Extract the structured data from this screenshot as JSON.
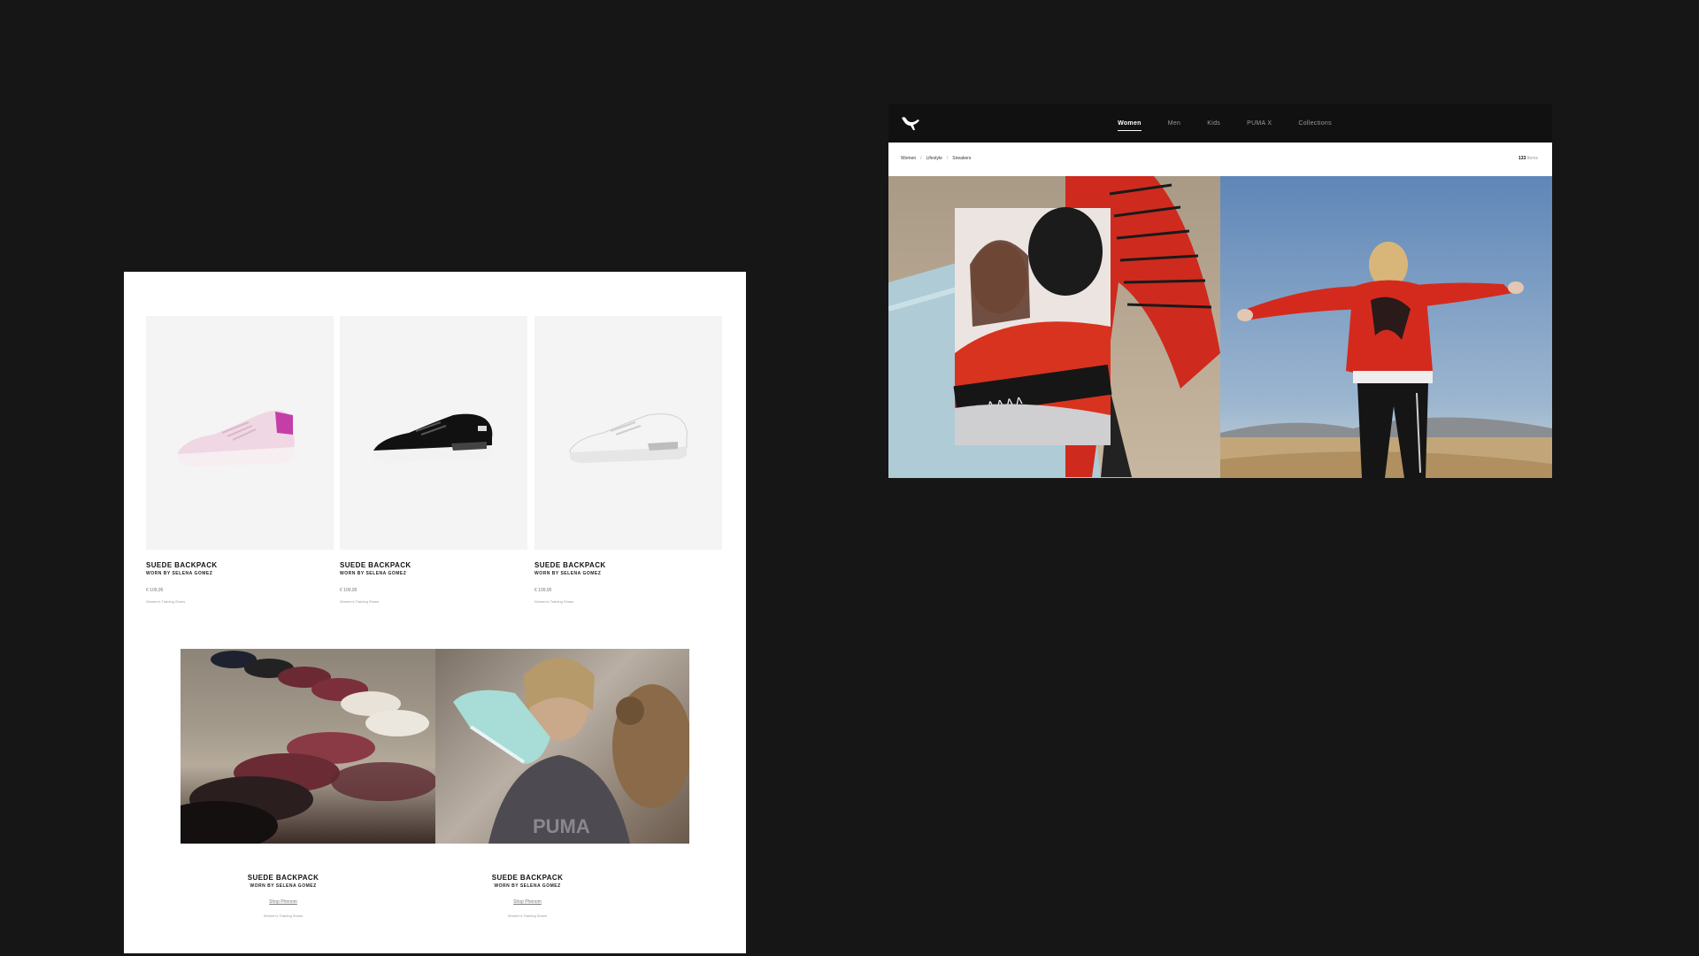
{
  "listing": {
    "products": [
      {
        "title": "SUEDE BACKPACK",
        "subtitle": "WORN BY SELENA GOMEZ",
        "price": "€ 109,95",
        "category": "Women's Training Shoes",
        "shoe_color": "pink"
      },
      {
        "title": "SUEDE BACKPACK",
        "subtitle": "WORN BY SELENA GOMEZ",
        "price": "€ 109,95",
        "category": "Women's Training Shoes",
        "shoe_color": "black"
      },
      {
        "title": "SUEDE BACKPACK",
        "subtitle": "WORN BY SELENA GOMEZ",
        "price": "€ 109,95",
        "category": "Women's Training Shoes",
        "shoe_color": "white"
      }
    ],
    "promos": [
      {
        "title": "SUEDE BACKPACK",
        "subtitle": "WORN BY SELENA GOMEZ",
        "link": "Shop Phenom",
        "category": "Women's Training Shoes"
      },
      {
        "title": "SUEDE BACKPACK",
        "subtitle": "WORN BY SELENA GOMEZ",
        "link": "Shop Phenom",
        "category": "Women's Training Shoes"
      }
    ]
  },
  "page": {
    "nav": {
      "logo_icon": "puma-cat-logo",
      "links": [
        {
          "label": "Women",
          "active": true
        },
        {
          "label": "Men",
          "active": false
        },
        {
          "label": "Kids",
          "active": false
        },
        {
          "label": "PUMA X",
          "active": false
        },
        {
          "label": "Collections",
          "active": false
        }
      ]
    },
    "breadcrumb": [
      "Women",
      "Lifestyle",
      "Sneakers"
    ],
    "item_count": {
      "number": "133",
      "label": "Items"
    }
  },
  "colors": {
    "background": "#161616",
    "nav_background": "#111111",
    "product_tile": "#f4f4f4",
    "jacket_red": "#d42a1e"
  }
}
